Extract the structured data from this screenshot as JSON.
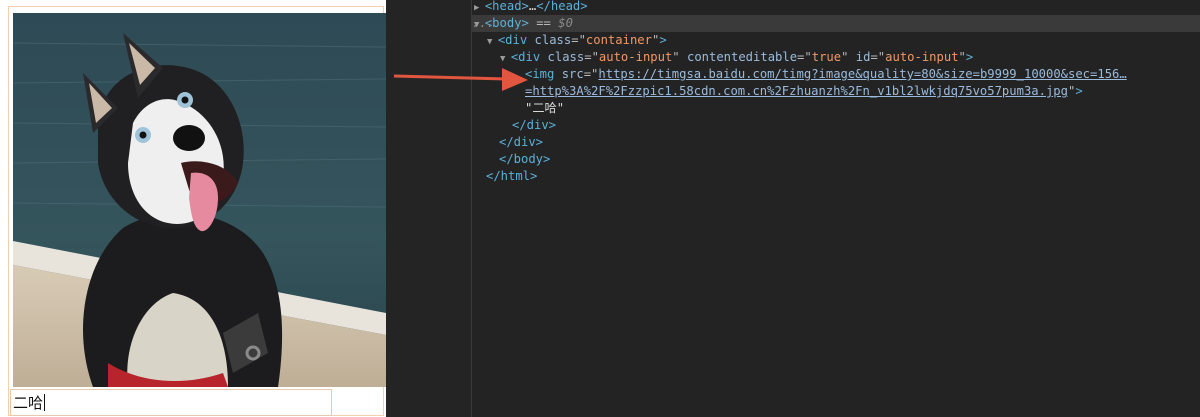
{
  "preview": {
    "input_text": "二哈"
  },
  "devtools": {
    "lines": [
      {
        "indent": 0,
        "toggle": "▶",
        "parts": [
          [
            "tag",
            "<head>"
          ],
          [
            "txt",
            "…"
          ],
          [
            "tag",
            "</head>"
          ]
        ]
      },
      {
        "indent": 0,
        "toggle": "▼",
        "selected": true,
        "prefix": "...",
        "parts": [
          [
            "tag",
            "<body>"
          ],
          [
            "eq",
            " == "
          ],
          [
            "muted",
            "$0"
          ]
        ]
      },
      {
        "indent": 1,
        "toggle": "▼",
        "parts": [
          [
            "tag",
            "<div"
          ],
          [
            "eq",
            " "
          ],
          [
            "attr",
            "class"
          ],
          [
            "eq",
            "=\""
          ],
          [
            "val",
            "container"
          ],
          [
            "eq",
            "\""
          ],
          [
            "tag",
            ">"
          ]
        ]
      },
      {
        "indent": 2,
        "toggle": "▼",
        "parts": [
          [
            "tag",
            "<div"
          ],
          [
            "eq",
            " "
          ],
          [
            "attr",
            "class"
          ],
          [
            "eq",
            "=\""
          ],
          [
            "val",
            "auto-input"
          ],
          [
            "eq",
            "\" "
          ],
          [
            "attr",
            "contenteditable"
          ],
          [
            "eq",
            "=\""
          ],
          [
            "val",
            "true"
          ],
          [
            "eq",
            "\" "
          ],
          [
            "attr",
            "id"
          ],
          [
            "eq",
            "=\""
          ],
          [
            "val",
            "auto-input"
          ],
          [
            "eq",
            "\""
          ],
          [
            "tag",
            ">"
          ]
        ]
      },
      {
        "indent": 3,
        "toggle": "",
        "parts": [
          [
            "tag",
            "<img"
          ],
          [
            "eq",
            " "
          ],
          [
            "attr",
            "src"
          ],
          [
            "eq",
            "=\""
          ],
          [
            "link",
            "https://timgsa.baidu.com/timg?image&quality=80&size=b9999_10000&sec=156…"
          ]
        ]
      },
      {
        "indent": 3,
        "toggle": "",
        "parts": [
          [
            "link",
            "=http%3A%2F%2Fzzpic1.58cdn.com.cn%2Fzhuanzh%2Fn_v1bl2lwkjdq75vo57pum3a.jpg"
          ],
          [
            "eq",
            "\""
          ],
          [
            "tag",
            ">"
          ]
        ]
      },
      {
        "indent": 3,
        "toggle": "",
        "parts": [
          [
            "txt",
            "\"二哈\""
          ]
        ]
      },
      {
        "indent": 2,
        "toggle": "",
        "parts": [
          [
            "tag",
            "</div>"
          ]
        ]
      },
      {
        "indent": 1,
        "toggle": "",
        "parts": [
          [
            "tag",
            "</div>"
          ]
        ]
      },
      {
        "indent": 0,
        "toggle": "",
        "extra_indent": 1,
        "parts": [
          [
            "tag",
            "</body>"
          ]
        ]
      },
      {
        "indent": 0,
        "toggle": "",
        "parts": [
          [
            "tag",
            "</html>"
          ]
        ]
      }
    ]
  },
  "colors": {
    "devtools_bg": "#232323",
    "tag": "#5db0d7",
    "attribute_value": "#f29766",
    "arrow": "#e2553f"
  }
}
